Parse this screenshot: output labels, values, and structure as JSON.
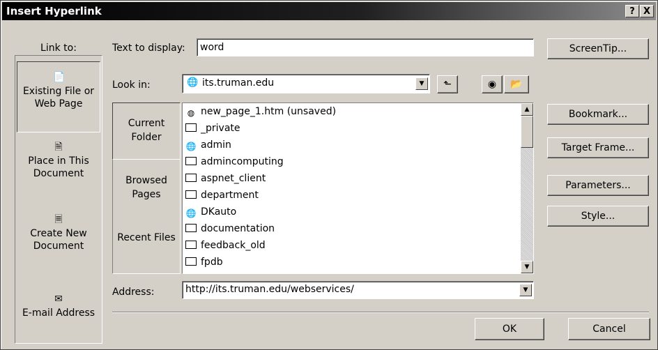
{
  "title": "Insert Hyperlink",
  "title_buttons": {
    "help": "?",
    "close": "X"
  },
  "link_to": {
    "heading": "Link to:",
    "items": [
      {
        "label": "Existing File or Web Page",
        "icon": "existing-file-icon",
        "selected": true
      },
      {
        "label": "Place in This Document",
        "icon": "document-place-icon",
        "selected": false
      },
      {
        "label": "Create New Document",
        "icon": "new-document-icon",
        "selected": false
      },
      {
        "label": "E-mail Address",
        "icon": "email-icon",
        "selected": false
      }
    ]
  },
  "text_to_display": {
    "label": "Text to display:",
    "value": "word"
  },
  "screentip_label": "ScreenTip...",
  "look_in": {
    "label": "Look in:",
    "value": "its.truman.edu"
  },
  "tabs": [
    {
      "label": "Current Folder",
      "selected": true
    },
    {
      "label": "Browsed Pages",
      "selected": false
    },
    {
      "label": "Recent Files",
      "selected": false
    }
  ],
  "files": [
    {
      "name": "new_page_1.htm (unsaved)",
      "icon": "ie-page-icon"
    },
    {
      "name": "_private",
      "icon": "folder-icon"
    },
    {
      "name": "admin",
      "icon": "web-folder-icon"
    },
    {
      "name": "admincomputing",
      "icon": "folder-icon"
    },
    {
      "name": "aspnet_client",
      "icon": "folder-icon"
    },
    {
      "name": "department",
      "icon": "folder-icon"
    },
    {
      "name": "DKauto",
      "icon": "web-folder-icon"
    },
    {
      "name": "documentation",
      "icon": "folder-icon"
    },
    {
      "name": "feedback_old",
      "icon": "folder-icon"
    },
    {
      "name": "fpdb",
      "icon": "folder-icon"
    }
  ],
  "address": {
    "label": "Address:",
    "value": "http://its.truman.edu/webservices/"
  },
  "right_buttons": {
    "bookmark": "Bookmark...",
    "target_frame": "Target Frame...",
    "parameters": "Parameters...",
    "style": "Style..."
  },
  "ok_label": "OK",
  "cancel_label": "Cancel"
}
